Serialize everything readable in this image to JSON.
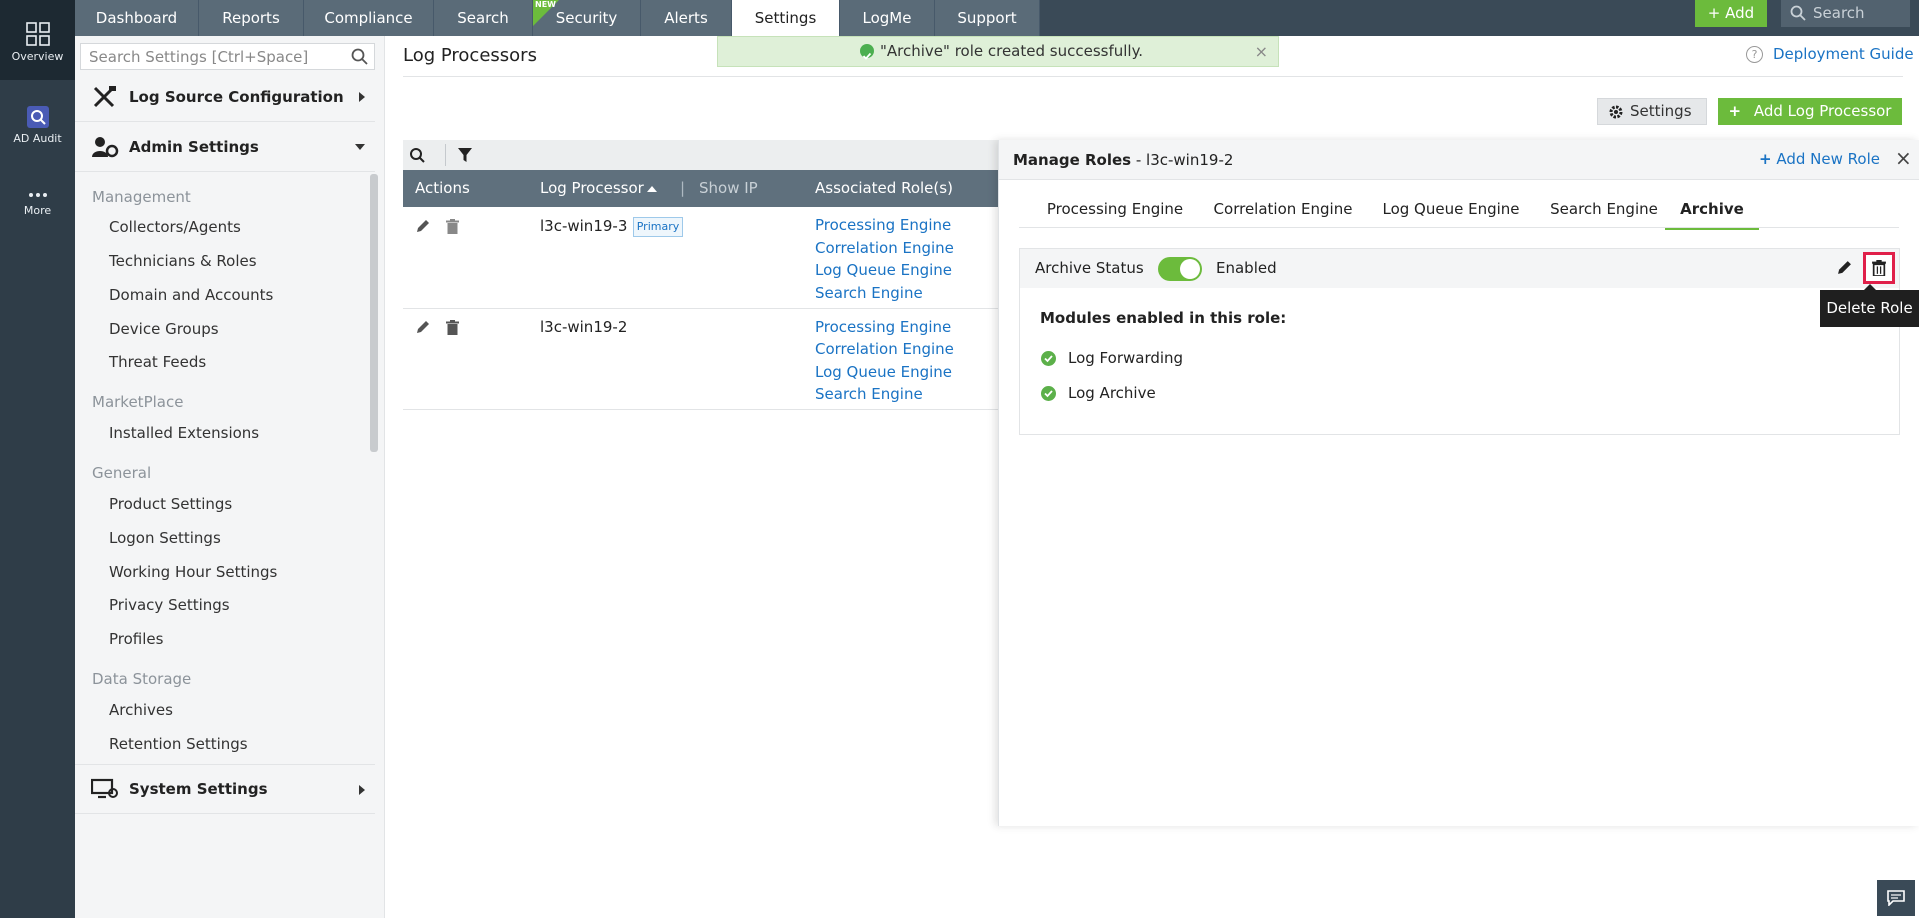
{
  "rail": {
    "items": [
      {
        "label": "Overview",
        "icon": "grid-icon"
      },
      {
        "label": "AD Audit",
        "icon": "ad-audit-icon"
      },
      {
        "label": "More",
        "icon": "more-icon"
      }
    ]
  },
  "topnav": {
    "tabs": [
      "Dashboard",
      "Reports",
      "Compliance",
      "Search",
      "Security",
      "Alerts",
      "Settings",
      "LogMe",
      "Support"
    ],
    "active_tab": "Settings",
    "new_badge": "NEW",
    "add_label": "+ Add",
    "search_placeholder": "Search"
  },
  "sidebar": {
    "search_placeholder": "Search Settings [Ctrl+Space]",
    "sections": {
      "log_source": "Log Source Configuration",
      "admin": "Admin Settings",
      "system": "System Settings"
    },
    "groups": {
      "management": "Management",
      "marketplace": "MarketPlace",
      "general": "General",
      "data_storage": "Data Storage"
    },
    "links": {
      "collectors": "Collectors/Agents",
      "technicians": "Technicians & Roles",
      "domain": "Domain and Accounts",
      "device_groups": "Device Groups",
      "threat_feeds": "Threat Feeds",
      "installed_ext": "Installed Extensions",
      "product_settings": "Product Settings",
      "logon_settings": "Logon Settings",
      "working_hour": "Working Hour Settings",
      "privacy": "Privacy Settings",
      "profiles": "Profiles",
      "archives": "Archives",
      "retention": "Retention Settings"
    }
  },
  "main": {
    "title": "Log Processors",
    "deployment_guide": "Deployment Guide",
    "toast": "\"Archive\" role created successfully.",
    "settings_btn": "Settings",
    "add_processor_btn": "Add Log Processor",
    "table": {
      "headers": {
        "actions": "Actions",
        "processor": "Log Processor",
        "show_ip": "Show IP",
        "roles": "Associated Role(s)"
      },
      "rows": [
        {
          "name": "l3c-win19-3",
          "badge": "Primary",
          "roles": [
            "Processing Engine",
            "Correlation Engine",
            "Log Queue Engine",
            "Search Engine"
          ]
        },
        {
          "name": "l3c-win19-2",
          "roles": [
            "Processing Engine",
            "Correlation Engine",
            "Log Queue Engine",
            "Search Engine"
          ]
        }
      ]
    }
  },
  "panel": {
    "title_bold": "Manage Roles",
    "title_rest": " - l3c-win19-2",
    "add_role": "Add New Role",
    "tabs": [
      "Processing Engine",
      "Correlation Engine",
      "Log Queue Engine",
      "Search Engine",
      "Archive"
    ],
    "active_tab": "Archive",
    "status_label": "Archive Status",
    "status_value": "Enabled",
    "status_on": true,
    "modules_title": "Modules enabled in this role:",
    "modules": [
      "Log Forwarding",
      "Log Archive"
    ],
    "tooltip": "Delete Role"
  },
  "colors": {
    "accent_green": "#6cbb3c",
    "link_blue": "#1a73c4",
    "nav_bg": "#3a4a57",
    "delete_highlight": "#e0204a"
  }
}
